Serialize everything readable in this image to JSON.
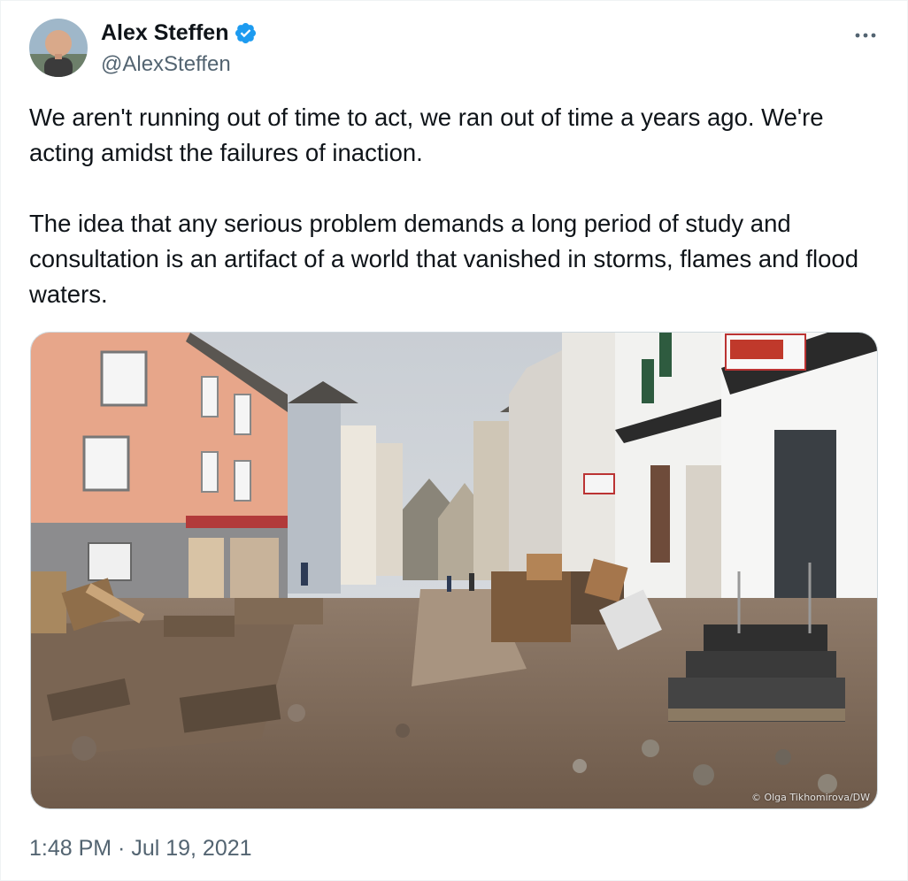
{
  "author": {
    "name": "Alex Steffen",
    "handle": "@AlexSteffen",
    "verified": true,
    "avatar_icon": "avatar-photo"
  },
  "tweet": {
    "paragraph_1": "We aren't running out of time to act, we ran out of time a years ago. We're acting amidst the failures of inaction.",
    "paragraph_2": "The idea that any serious problem demands a long period of study and consultation is an artifact of a world that vanished in storms, flames and flood waters."
  },
  "media": {
    "photo_credit": "© Olga Tikhomirova/DW",
    "description_icon": "flood-damaged-street-photo"
  },
  "meta": {
    "timestamp": "1:48 PM · Jul 19, 2021"
  },
  "colors": {
    "text": "#0f1419",
    "secondary": "#536471",
    "verified_blue": "#1d9bf0"
  },
  "icons": {
    "more": "more-options-icon",
    "verified": "verified-badge-icon"
  }
}
